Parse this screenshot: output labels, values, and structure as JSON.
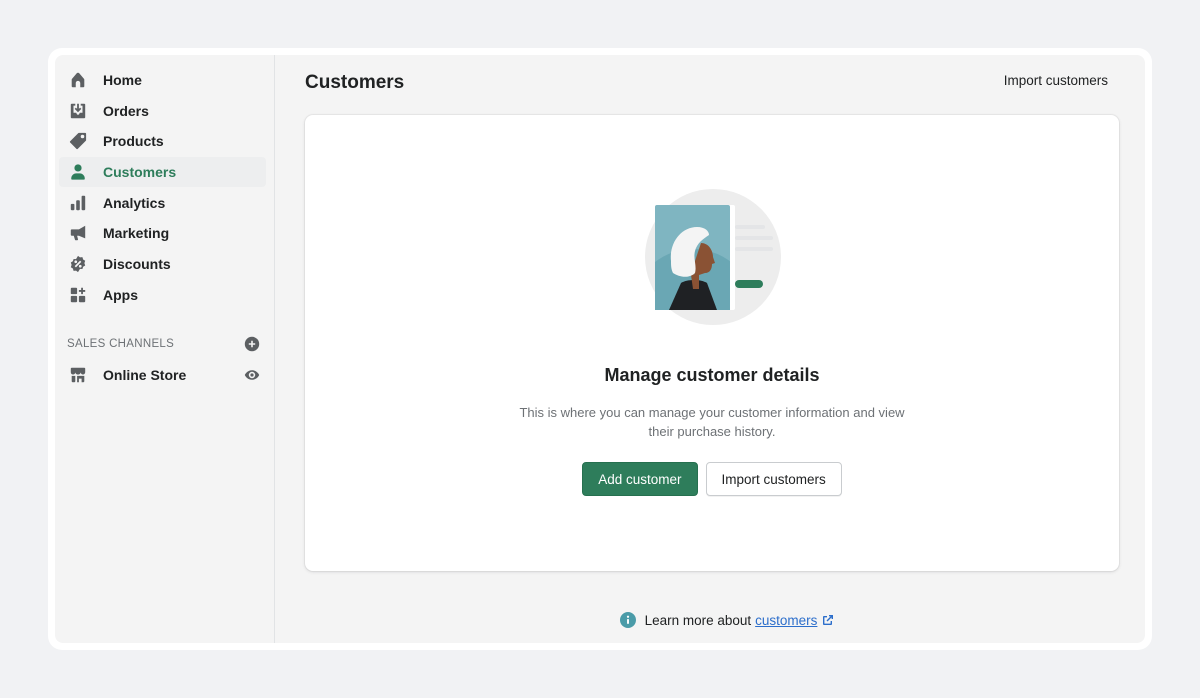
{
  "sidebar": {
    "items": [
      {
        "label": "Home",
        "icon": "home-icon",
        "active": false
      },
      {
        "label": "Orders",
        "icon": "orders-icon",
        "active": false
      },
      {
        "label": "Products",
        "icon": "tag-icon",
        "active": false
      },
      {
        "label": "Customers",
        "icon": "person-icon",
        "active": true
      },
      {
        "label": "Analytics",
        "icon": "bar-chart-icon",
        "active": false
      },
      {
        "label": "Marketing",
        "icon": "megaphone-icon",
        "active": false
      },
      {
        "label": "Discounts",
        "icon": "discount-icon",
        "active": false
      },
      {
        "label": "Apps",
        "icon": "apps-icon",
        "active": false
      }
    ],
    "sales_channels": {
      "title": "SALES CHANNELS",
      "add_icon": "plus-circle-icon",
      "items": [
        {
          "label": "Online Store",
          "icon": "store-icon",
          "action_icon": "eye-icon"
        }
      ]
    }
  },
  "header": {
    "title": "Customers",
    "action_label": "Import customers"
  },
  "empty_state": {
    "title": "Manage customer details",
    "description": "This is where you can manage your customer information and view their purchase history.",
    "primary_label": "Add customer",
    "secondary_label": "Import customers"
  },
  "footer": {
    "text": "Learn more about",
    "link_label": "customers",
    "info_icon": "info-icon",
    "external_icon": "external-link-icon"
  },
  "colors": {
    "accent": "#2e7d5b",
    "link": "#2c6ecb",
    "info": "#4a9ba8"
  }
}
